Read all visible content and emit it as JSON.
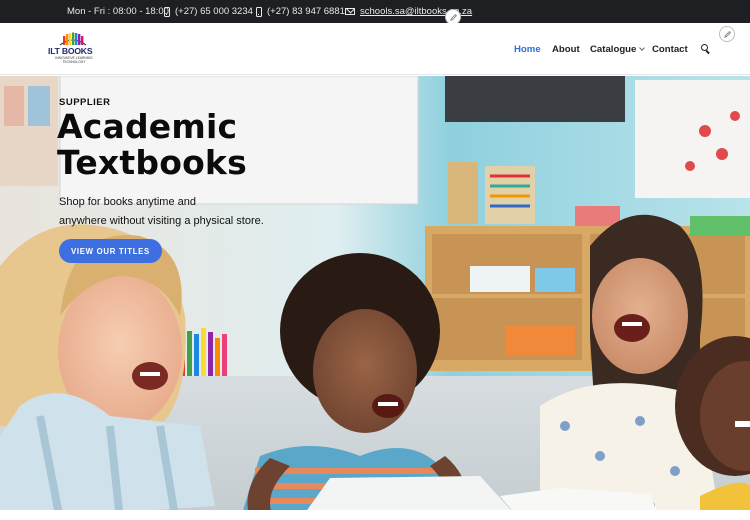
{
  "topbar": {
    "hours": "Mon - Fri : 08:00 - 18:00",
    "phone1": "(+27) 65 000 3234",
    "phone2": "(+27) 83 947 6881",
    "email": "schools.sa@iltbooks.co.za",
    "icons": [
      "phone-icon",
      "mobile-icon",
      "mail-icon"
    ]
  },
  "header": {
    "logo": {
      "title": "ILT BOOKS",
      "tagline": "INNOVATIVE LEARNING TECHNOLOGY"
    },
    "nav": [
      {
        "label": "Home",
        "active": true
      },
      {
        "label": "About"
      },
      {
        "label": "Catalogue",
        "dropdown": true
      },
      {
        "label": "Contact"
      }
    ],
    "search_icon": "search-icon"
  },
  "hero": {
    "eyebrow": "SUPPLIER",
    "headline_line1": "Academic",
    "headline_line2": "Textbooks",
    "subtext_line1": "Shop for books anytime and",
    "subtext_line2": "anywhere without visiting a physical store.",
    "cta_label": "VIEW OUR TITLES",
    "image_description": "children-laughing-classroom"
  },
  "colors": {
    "topbar_bg": "#1d1f22",
    "accent_blue": "#2f6fd6",
    "cta_blue": "#3d6fe0"
  }
}
